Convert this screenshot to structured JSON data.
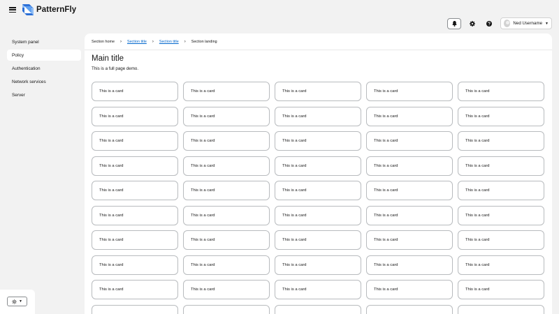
{
  "brand": {
    "name": "PatternFly"
  },
  "header": {
    "user_name": "Ned Username"
  },
  "sidebar": {
    "items": [
      {
        "label": "System panel",
        "active": false
      },
      {
        "label": "Policy",
        "active": true
      },
      {
        "label": "Authentication",
        "active": false
      },
      {
        "label": "Network services",
        "active": false
      },
      {
        "label": "Server",
        "active": false
      }
    ]
  },
  "breadcrumb": [
    {
      "label": "Section home",
      "link": false
    },
    {
      "label": "Section title",
      "link": true
    },
    {
      "label": "Section title",
      "link": true
    },
    {
      "label": "Section landing",
      "link": false
    }
  ],
  "main": {
    "title": "Main title",
    "subtitle": "This is a full page demo."
  },
  "cards": [
    "This is a card",
    "This is a card",
    "This is a card",
    "This is a card",
    "This is a card",
    "This is a card",
    "This is a card",
    "This is a card",
    "This is a card",
    "This is a card",
    "This is a card",
    "This is a card",
    "This is a card",
    "This is a card",
    "This is a card",
    "This is a card",
    "This is a card",
    "This is a card",
    "This is a card",
    "This is a card",
    "This is a card",
    "This is a card",
    "This is a card",
    "This is a card",
    "This is a card",
    "This is a card",
    "This is a card",
    "This is a card",
    "This is a card",
    "This is a card",
    "This is a card",
    "This is a card",
    "This is a card",
    "This is a card",
    "This is a card",
    "This is a card",
    "This is a card",
    "This is a card",
    "This is a card",
    "This is a card",
    "This is a card",
    "This is a card",
    "This is a card",
    "This is a card",
    "This is a card",
    "",
    "",
    "",
    "",
    ""
  ],
  "icons": {
    "menu": "hamburger-icon",
    "notifications": "bell-icon",
    "settings": "gear-icon",
    "help": "help-icon",
    "theme": "sun-icon"
  },
  "colors": {
    "link": "#0066cc",
    "background": "#f2f2f2",
    "surface": "#ffffff",
    "brand_blue": "#1a5ed8"
  }
}
